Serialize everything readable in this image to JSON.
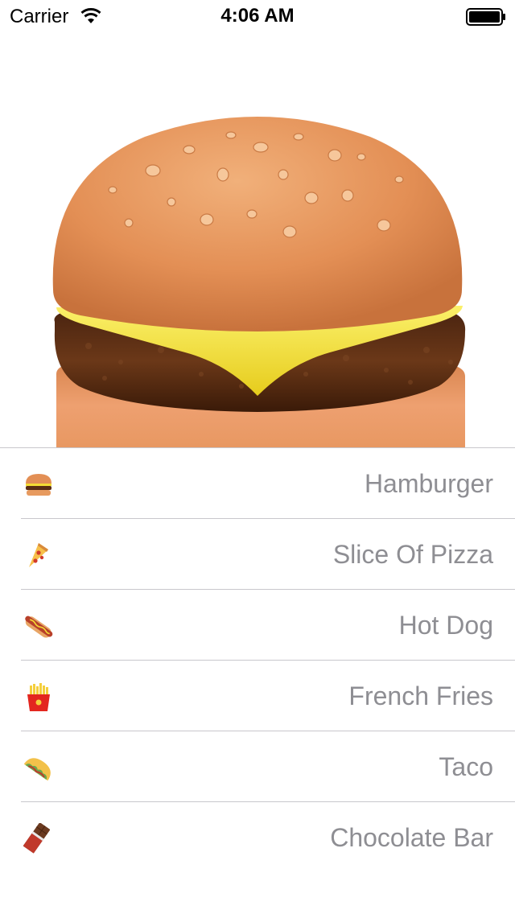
{
  "status_bar": {
    "carrier": "Carrier",
    "time": "4:06 AM",
    "wifi_icon": "wifi-icon",
    "battery_icon": "battery-full-icon"
  },
  "hero": {
    "image_name": "hamburger-emoji-large"
  },
  "food_list": {
    "items": [
      {
        "icon": "hamburger-icon",
        "label": "Hamburger"
      },
      {
        "icon": "pizza-slice-icon",
        "label": "Slice Of Pizza"
      },
      {
        "icon": "hot-dog-icon",
        "label": "Hot Dog"
      },
      {
        "icon": "french-fries-icon",
        "label": "French Fries"
      },
      {
        "icon": "taco-icon",
        "label": "Taco"
      },
      {
        "icon": "chocolate-bar-icon",
        "label": "Chocolate Bar"
      }
    ]
  },
  "colors": {
    "label_text": "#8e8e93",
    "separator": "#c8c7cc",
    "bun": "#e79a5f",
    "cheese": "#f6e33a",
    "patty": "#5b2e14"
  }
}
